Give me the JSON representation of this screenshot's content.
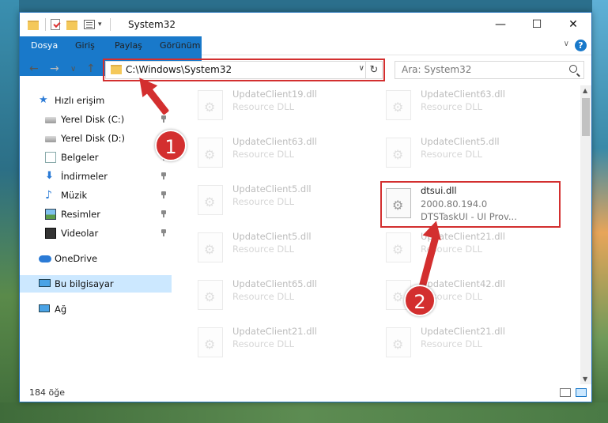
{
  "window": {
    "title": "System32",
    "minimize_glyph": "—",
    "maximize_glyph": "☐",
    "close_glyph": "✕"
  },
  "ribbon": {
    "tabs": [
      "Dosya",
      "Giriş",
      "Paylaş",
      "Görünüm"
    ],
    "help_glyph": "?",
    "collapse_glyph": "∨"
  },
  "nav": {
    "back_glyph": "←",
    "forward_glyph": "→",
    "recent_glyph": "∨",
    "up_glyph": "↑",
    "address": "C:\\Windows\\System32",
    "address_dropdown_glyph": "∨",
    "refresh_glyph": "↻",
    "search_placeholder": "Ara: System32"
  },
  "sidebar": {
    "items": [
      {
        "label": "Hızlı erişim",
        "icon": "star-icon"
      },
      {
        "label": "Yerel Disk (C:)",
        "icon": "disk-icon",
        "pinned": true
      },
      {
        "label": "Yerel Disk (D:)",
        "icon": "disk-icon"
      },
      {
        "label": "Belgeler",
        "icon": "documents-icon",
        "pinned": true
      },
      {
        "label": "İndirmeler",
        "icon": "downloads-icon",
        "pinned": true
      },
      {
        "label": "Müzik",
        "icon": "music-icon",
        "pinned": true
      },
      {
        "label": "Resimler",
        "icon": "pictures-icon",
        "pinned": true
      },
      {
        "label": "Videolar",
        "icon": "videos-icon",
        "pinned": true
      },
      {
        "label": "OneDrive",
        "icon": "onedrive-icon"
      },
      {
        "label": "Bu bilgisayar",
        "icon": "this-pc-icon",
        "selected": true
      },
      {
        "label": "Ağ",
        "icon": "network-icon"
      }
    ]
  },
  "files": [
    {
      "name": "UpdateClient19.dll",
      "desc": "Resource DLL"
    },
    {
      "name": "UpdateClient63.dll",
      "desc": "Resource DLL"
    },
    {
      "name": "UpdateClient63.dll",
      "desc": "Resource DLL"
    },
    {
      "name": "UpdateClient5.dll",
      "desc": "Resource DLL"
    },
    {
      "name": "UpdateClient5.dll",
      "desc": "Resource DLL"
    },
    {
      "name": "dtsui.dll",
      "desc": "2000.80.194.0",
      "desc2": "DTSTaskUI - UI Prov..."
    },
    {
      "name": "UpdateClient5.dll",
      "desc": "Resource DLL"
    },
    {
      "name": "UpdateClient21.dll",
      "desc": "Resource DLL"
    },
    {
      "name": "UpdateClient65.dll",
      "desc": "Resource DLL"
    },
    {
      "name": "UpdateClient42.dll",
      "desc": "Resource DLL"
    },
    {
      "name": "UpdateClient21.dll",
      "desc": "Resource DLL"
    },
    {
      "name": "UpdateClient21.dll",
      "desc": "Resource DLL"
    }
  ],
  "status": {
    "count_text": "184 öğe"
  },
  "annotations": {
    "badge1": "1",
    "badge2": "2",
    "color": "#d32f2f"
  }
}
